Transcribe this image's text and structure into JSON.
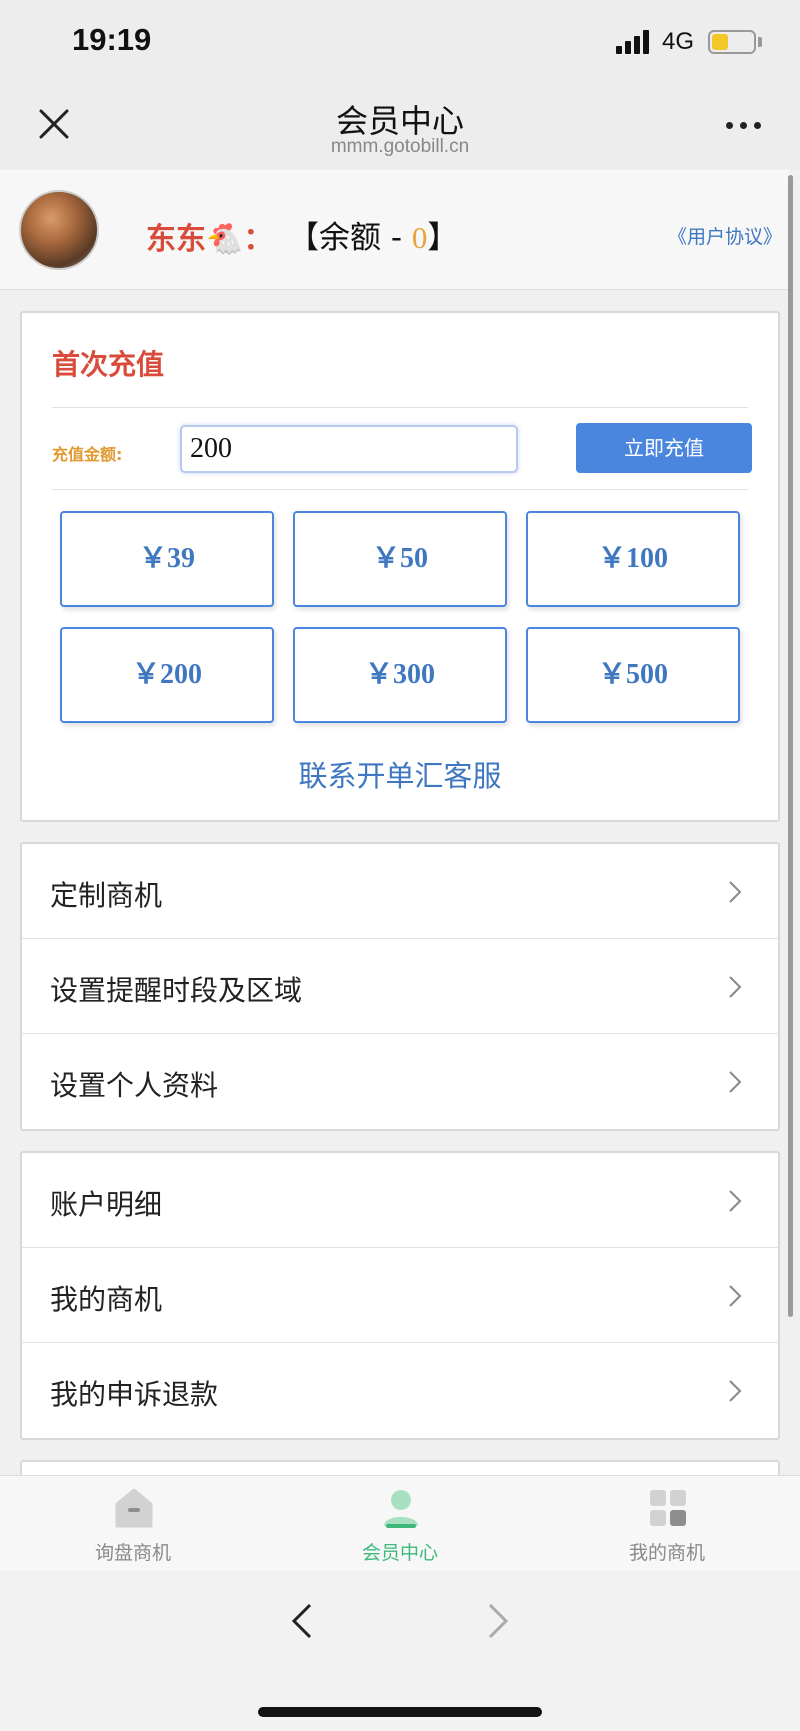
{
  "status_bar": {
    "time": "19:19",
    "network": "4G",
    "battery_level": 0.4,
    "battery_color": "#f4c728"
  },
  "nav": {
    "title": "会员中心",
    "subtitle": "mmm.gotobill.cn",
    "close_icon": "close-icon",
    "more_icon": "more-icon"
  },
  "user": {
    "name": "东东🐔：",
    "balance_prefix": "【余额 - ",
    "balance_value": "0",
    "balance_suffix": "】",
    "agreement_link": "《用户协议》"
  },
  "recharge": {
    "title": "首次充值",
    "amount_label": "充值金额:",
    "amount_value": "200",
    "button_label": "立即充值",
    "options": [
      "￥39",
      "￥50",
      "￥100",
      "￥200",
      "￥300",
      "￥500"
    ],
    "contact_link": "联系开单汇客服"
  },
  "menu_group_1": [
    {
      "label": "定制商机"
    },
    {
      "label": "设置提醒时段及区域"
    },
    {
      "label": "设置个人资料"
    }
  ],
  "menu_group_2": [
    {
      "label": "账户明细"
    },
    {
      "label": "我的商机"
    },
    {
      "label": "我的申诉退款"
    }
  ],
  "tab_bar": {
    "tabs": [
      {
        "label": "询盘商机",
        "icon": "home-icon",
        "active": false
      },
      {
        "label": "会员中心",
        "icon": "user-icon",
        "active": true
      },
      {
        "label": "我的商机",
        "icon": "grid-icon",
        "active": false
      }
    ]
  },
  "colors": {
    "accent_blue": "#4a86de",
    "title_red": "#d94b3b",
    "active_green": "#3fb87b",
    "label_orange": "#e09a32"
  }
}
